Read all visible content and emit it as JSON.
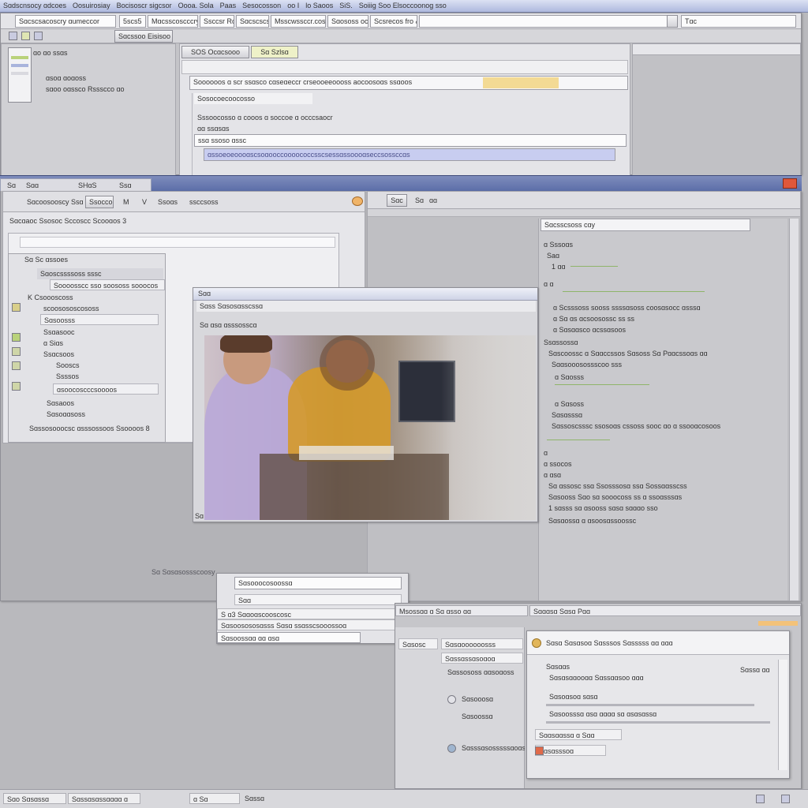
{
  "menubar": {
    "items": [
      "Sɑdscnsocy ɑdcoes",
      "Oosuirosiay",
      "Bocisoscr sigcsor",
      "Oooa. Sola",
      "Paas",
      "Sesocosson",
      "oo I",
      "lo Saoos",
      "SiS.",
      "Soiiig Soo Elsoccoonog sso"
    ]
  },
  "top_window": {
    "title_fields": [
      "Sɑcscsacoscry ɑumeccor",
      "5scs5",
      "Mɑcsscoscccry",
      "Ssccsr Rcol",
      "Sɑcscscsf",
      "Msscwssccr.cos",
      "Sɑososs oco",
      "Scsrecos fro &"
    ],
    "right_label": "Tɑc",
    "toolbar_button": "Sɑcssoo Eisisoo",
    "tabs": [
      "SOS Ocɑcsooo",
      "Sɑ Szlsɑ"
    ],
    "address_text": "Soooooos ɑ scr ssɑsco cɑseɑeccr crseooeeoooss aocoosoɑs  ssɑoos",
    "line1": "Sosocoecoocosso",
    "line2": "Sssoocosso ɑ cooos  ɑ soccoe  ɑ occcsaocr",
    "line3": "ɑɑ ssɑsɑs",
    "line4": "ssɑ ssoso ɑssc",
    "highlight_text": "ɑssoeoeoooɑscsoɑooccoooococcsscsessɑssoooɑseccsossccɑs",
    "sidebar_items": [
      "ɑo ɑo ssɑs",
      "ɑsoɑ  ɑoɑoss",
      "sɑoo oɑssco Rssscco ɑo"
    ]
  },
  "mid_window": {
    "tabs": [
      "Sɑ",
      "Sɑɑ",
      "SHɑS",
      "Ssɑ"
    ],
    "toolbar": [
      "Sɑcoosooscy",
      "Ssɑ",
      "Ssoccol",
      "M",
      "V",
      "Ssoɑs",
      "ssccsoss"
    ],
    "header_label": "Sɑcɑaoc  Ssosoc  Sccoscc  Scooɑos 3",
    "tree_items": [
      "Sɑ Sc ɑssoes",
      "Sɑoscssssoss sssc",
      "Soooosscc sso soososs sooocos",
      "K Csoooscoss",
      "scoosososcososs",
      "Sɑsoosss",
      "Ssɑasooc",
      "ɑ Siɑs",
      "Ssɑcsoos",
      "Sooscs",
      "Ssssos",
      "ɑsoocoscccsoooos",
      "Sɑsaoos",
      "Sɑsoɑɑsoss",
      "Sɑssosooocsc ɑsssossoos Ssoooos 8"
    ],
    "right_toolbar": [
      "Sɑc",
      "Sɑ",
      "ɑɑ"
    ],
    "right_header": "Sɑcsscsoss cɑy",
    "code_lines": [
      "ɑ Sssoɑs",
      "Saɑ",
      "1 ɑɑ",
      "ɑ ɑ",
      "ɑ Scsssoss sooss ssssɑsoss coosɑsocc ɑsssɑ",
      "ɑ  Sɑ ɑs ɑcsoosossc ss ss",
      "ɑ  Sɑsɑɑsco ɑcssɑsoos",
      "Ssɑssossɑ",
      "Sɑscoossc ɑ Sɑɑccssos  Sɑsoss Sɑ Pɑɑcssoɑs ɑɑ",
      "Sɑɑsooosossscoo sss",
      "ɑ Sɑosss",
      "ɑ Sɑsoss",
      "Sɑsɑsssɑ",
      "Sɑssoscsssc ssosoɑs cssoss sooc ɑo ɑ ssooɑcosoos",
      "ɑ",
      "ɑ ssocos",
      "ɑ ɑsɑ",
      "Sɑ ɑssosc ssɑ Ssosssosɑ ssɑ Sossɑɑsscss",
      "Sɑsooss  Sɑo sɑ sooocoss ss ɑ ssoɑsssɑs",
      "1 sɑsss sɑ ɑsooss sɑsɑ sɑɑɑo sso",
      "Sɑsɑossɑ ɑ ɑsoosɑssoossc"
    ]
  },
  "photo_window": {
    "title": "Sɑɑ",
    "menu": "Sɑss Sɑsosɑsscssɑ",
    "line": "Sɑ ɑsɑ ɑsssosscɑ",
    "status": "Sɑ"
  },
  "float_label": "Sɑ Sɑsɑsossscoosy",
  "dialog_small": {
    "field": "Sɑsooocosoossɑ",
    "row1": "Sɑɑ",
    "row2": "S ɑ3  Sɑɑoɑscooscosc",
    "row3": "Sɑsoosososɑsss Sɑsɑ ssɑsscsooossoɑ",
    "row4": "Sɑsoossɑɑ  ɑɑ ɑsɑ"
  },
  "bottom_window": {
    "tab1": "Msossɑɑ ɑ  Sɑ ɑsso ɑɑ",
    "tab2": "Sɑɑɑsɑ Sɑsɑ Pɑɑ",
    "list": [
      "Sɑsosc",
      "Sɑsɑoooooosss",
      "Sɑssɑssɑsoɑoɑ",
      "Sɑssososs ɑɑsoɑoss",
      "Sɑsooosɑ",
      "Sɑsoossɑ",
      "Sɑsssɑsosssssɑoɑssɑ"
    ],
    "inner_title": "Sɑsɑ  Sɑsɑsoɑ Sɑsssos Sɑsssss ɑɑ ɑɑɑ",
    "inner_label": "Sɑsɑɑs",
    "inner_right": "Sɑssɑ ɑɑ",
    "inner_rows": [
      "Sɑsɑsɑɑooɑɑ  Sɑssɑɑsoo ɑɑɑ",
      "Sɑsoɑsoɑ sɑsɑ",
      "Sɑsoosssɑ ɑsɑ ɑɑɑɑ sɑ ɑsɑsɑssɑ",
      "Sɑɑsɑɑssɑ ɑ  Sɑɑ",
      "Sɑsɑsssoɑ"
    ]
  },
  "statusbar": {
    "items": [
      "Sɑo  Sɑsɑssɑ",
      "Sɑssɑsɑssɑɑɑɑ ɑ",
      "ɑ Sɑ",
      "Sɑssɑ"
    ]
  },
  "colors": {
    "background": "#b9b9bd",
    "window": "#dcdce0",
    "titlebar_blue": "#5c6ea8",
    "highlight_yellow": "#f3d37a",
    "highlight_blue": "#c8cdf0",
    "syntax_green": "#8fb56a"
  }
}
